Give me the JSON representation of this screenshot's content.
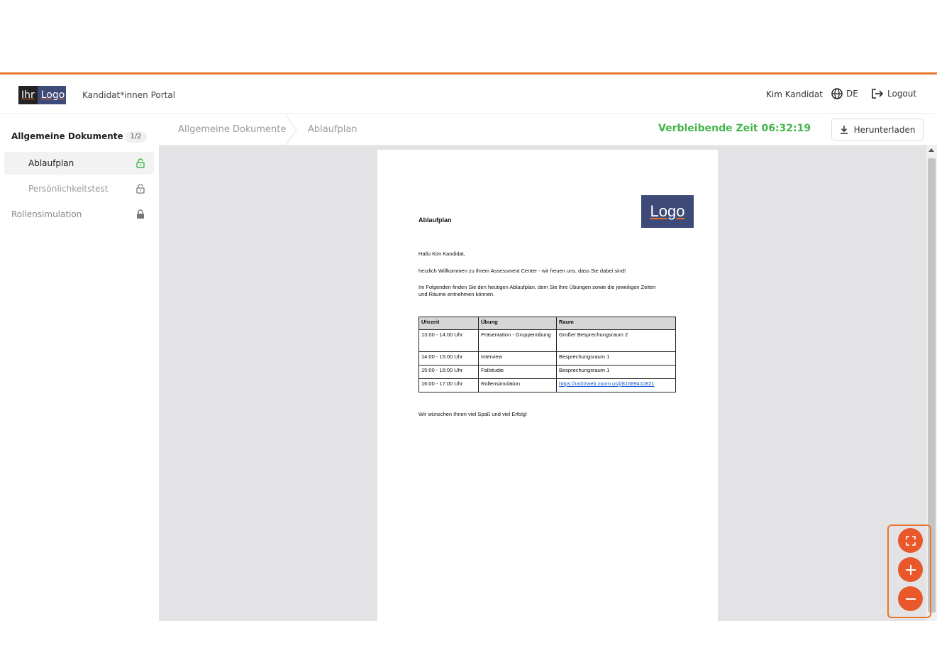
{
  "colors": {
    "accent": "#e8772e",
    "timer": "#43b649",
    "brand_bg": "#3e4a78"
  },
  "header": {
    "logo_part1": "Ihr",
    "logo_part2": "Logo",
    "portal_title": "Kandidat*innen Portal",
    "user_name": "Kim Kandidat",
    "language": "DE",
    "logout_label": "Logout"
  },
  "sidebar": {
    "group_label": "Allgemeine Dokumente",
    "group_count": "1/2",
    "items": [
      {
        "label": "Ablaufplan",
        "state": "unlocked-active"
      },
      {
        "label": "Persönlichkeitstest",
        "state": "unlocked"
      },
      {
        "label": "Rollensimulation",
        "state": "locked"
      }
    ]
  },
  "toolbar": {
    "breadcrumb": [
      "Allgemeine Dokumente",
      "Ablaufplan"
    ],
    "timer_text": "Verbleibende Zeit 06:32:19",
    "download_label": "Herunterladen"
  },
  "document": {
    "logo_text": "Logo",
    "title": "Ablaufplan",
    "greeting": "Hallo Kim Kandidat,",
    "welcome": "herzlich Willkommen zu Ihrem Assessment Center - wir freuen uns, dass Sie dabei sind!",
    "intro": "Im Folgenden finden Sie den heutigen Ablaufplan, dem Sie Ihre Übungen sowie die jeweiligen Zeiten und Räume entnehmen können.",
    "table_headers": [
      "Uhrzeit",
      "Übung",
      "Raum"
    ],
    "table_rows": [
      [
        "13:00 - 14:00 Uhr",
        "Präsentation - Gruppenübung",
        "Großer Besprechungsraum 2"
      ],
      [
        "14:00 - 15:00 Uhr",
        "Interview",
        "Besprechungsraum 1"
      ],
      [
        "15:00 - 16:00 Uhr",
        "Fallstudie",
        "Besprechungsraum 1"
      ],
      [
        "16:00 - 17:00 Uhr",
        "Rollensimulation",
        "https://us02web.zoom.us/j/81689410821"
      ]
    ],
    "closing": "Wir wünschen Ihnen viel Spaß und viel Erfolg!"
  },
  "zoom_controls": {
    "icons": [
      "fullscreen-icon",
      "zoom-in-icon",
      "zoom-out-icon"
    ]
  }
}
